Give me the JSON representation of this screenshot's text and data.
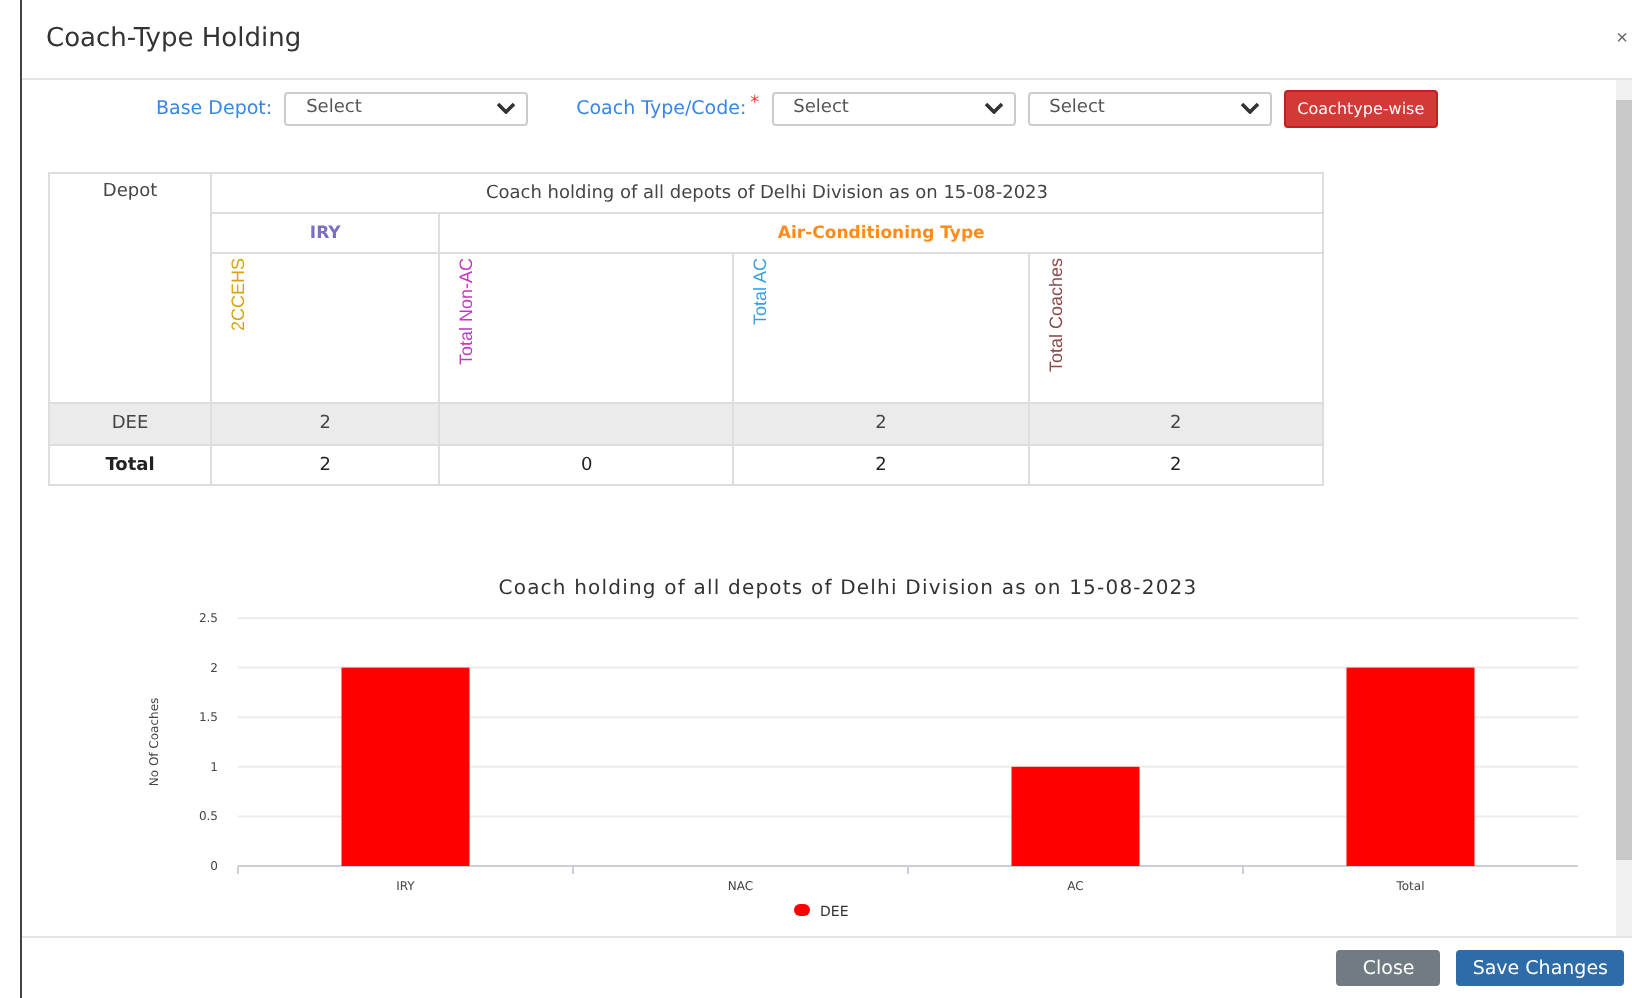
{
  "dialog": {
    "title": "Coach-Type Holding",
    "close": "×"
  },
  "filters": {
    "base_depot_label": "Base Depot:",
    "base_depot": {
      "placeholder": "Select"
    },
    "coach_type_label": "Coach Type/Code:",
    "required_mark": "*",
    "coach_type": {
      "placeholder": "Select"
    },
    "coach_code": {
      "placeholder": "Select"
    },
    "button": "Coachtype-wise"
  },
  "table": {
    "depot_header": "Depot",
    "title": "Coach holding of all depots of Delhi Division as on 15-08-2023",
    "groups": [
      {
        "label": "IRY",
        "color": "#7a6fc0"
      },
      {
        "label": "Air-Conditioning Type",
        "color": "#ff8c1a"
      }
    ],
    "columns": [
      {
        "label": "2CCEHS",
        "color": "#d4a514"
      },
      {
        "label": "Total Non-AC",
        "color": "#c736c0"
      },
      {
        "label": "Total AC",
        "color": "#3aa0dd"
      },
      {
        "label": "Total Coaches",
        "color": "#8a4a4a"
      }
    ],
    "rows": [
      {
        "depot": "DEE",
        "cells": [
          "2",
          null,
          "2",
          "2"
        ],
        "kind": "data"
      },
      {
        "depot": "Total",
        "cells": [
          "2",
          "0",
          "2",
          "2"
        ],
        "kind": "total"
      }
    ]
  },
  "chart_data": {
    "type": "bar",
    "title": "Coach holding of all depots of Delhi Division as on 15-08-2023",
    "ylabel": "No Of Coaches",
    "categories": [
      "IRY",
      "NAC",
      "AC",
      "Total"
    ],
    "series": [
      {
        "name": "DEE",
        "color": "#ff0000",
        "values": [
          2,
          0,
          1,
          2
        ]
      }
    ],
    "ylim": [
      0,
      2.5
    ],
    "yticks": [
      0,
      0.5,
      1,
      1.5,
      2,
      2.5
    ],
    "grid": true
  },
  "footer": {
    "buttons": [
      {
        "label": "Close",
        "kind": "secondary"
      },
      {
        "label": "Save Changes",
        "kind": "primary"
      }
    ]
  }
}
